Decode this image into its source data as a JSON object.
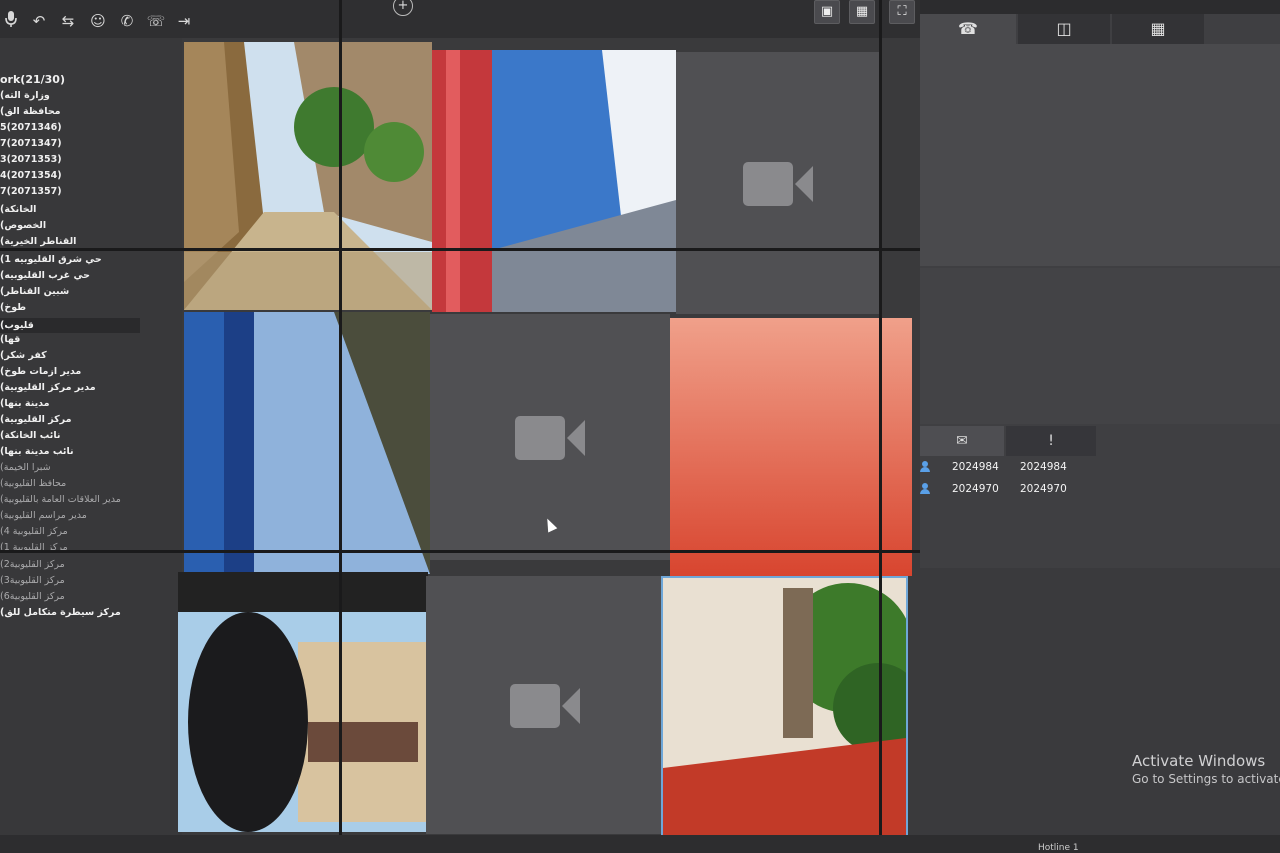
{
  "toolbar": {
    "icons": [
      "microphone-icon",
      "call-back-icon",
      "transfer-icon",
      "contact-icon",
      "phone-icon",
      "hangup-icon",
      "exit-icon"
    ],
    "add_camera_glyph": "+",
    "screen_layout_glyph": "▣",
    "grid_layout_glyph": "▦",
    "fullscreen_glyph": "⛶"
  },
  "tree": {
    "items": [
      {
        "label": "ork(21/30)",
        "dim": false
      },
      {
        "label": "(وزارة الته",
        "dim": false
      },
      {
        "label": "(محافظة الق",
        "dim": false
      },
      {
        "label": "5(2071346)",
        "dim": false
      },
      {
        "label": "7(2071347)",
        "dim": false
      },
      {
        "label": "3(2071353)",
        "dim": false
      },
      {
        "label": "4(2071354)",
        "dim": false
      },
      {
        "label": "7(2071357)",
        "dim": false
      },
      {
        "label": "(الخانكة",
        "dim": false
      },
      {
        "label": "(الخصوص",
        "dim": false
      },
      {
        "label": "(القناطر الخيرية",
        "dim": false
      },
      {
        "label": "(حي شرق القليوبيه 1",
        "dim": false
      },
      {
        "label": "(حي غرب القليوبيه",
        "dim": false
      },
      {
        "label": "(شبين القناطر",
        "dim": false
      },
      {
        "label": "(طوخ",
        "dim": false
      },
      {
        "label": "(قليوب",
        "dim": false
      },
      {
        "label": "(قها",
        "dim": false
      },
      {
        "label": "(كفر شكر",
        "dim": false
      },
      {
        "label": "(مدير ازمات طوخ",
        "dim": false
      },
      {
        "label": "(مدير مركز القليوبية",
        "dim": false
      },
      {
        "label": "(مدينة بنها",
        "dim": false
      },
      {
        "label": "(مركز القليوبية",
        "dim": false
      },
      {
        "label": "(نائب الخانكة",
        "dim": false
      },
      {
        "label": "(نائب مدينة بنها",
        "dim": false
      },
      {
        "label": "(شبرا الخيمة",
        "dim": true
      },
      {
        "label": "(محافظ القليوبية",
        "dim": true
      },
      {
        "label": "(مدير العلاقات العامة بالقليوبية",
        "dim": true
      },
      {
        "label": "(مدير مراسم القليوبية",
        "dim": true
      },
      {
        "label": "(مركز القليوبية 4",
        "dim": true
      },
      {
        "label": "(مركز القليوبية 1",
        "dim": true
      },
      {
        "label": "(مركز القليوبية2",
        "dim": true
      },
      {
        "label": "(مركز القليوبية3",
        "dim": true
      },
      {
        "label": "(مركز القليوبية6",
        "dim": true
      },
      {
        "label": "(مركز سيطرة متكامل للق",
        "dim": false
      }
    ]
  },
  "video_wall": {
    "tiles": [
      {
        "id": "tile-1",
        "state": "live"
      },
      {
        "id": "tile-2",
        "state": "live"
      },
      {
        "id": "tile-3",
        "state": "empty"
      },
      {
        "id": "tile-4",
        "state": "live"
      },
      {
        "id": "tile-5",
        "state": "empty"
      },
      {
        "id": "tile-6",
        "state": "live"
      },
      {
        "id": "tile-7",
        "state": "live"
      },
      {
        "id": "tile-8",
        "state": "empty"
      },
      {
        "id": "tile-9",
        "state": "live",
        "selected": true
      }
    ]
  },
  "right_panel": {
    "tabs": [
      {
        "icon": "phone-icon",
        "glyph": "☎"
      },
      {
        "icon": "cctv-icon",
        "glyph": "◫"
      },
      {
        "icon": "video-grid-icon",
        "glyph": "▦"
      }
    ],
    "message_tabs": [
      {
        "icon": "mail-icon",
        "glyph": "✉"
      },
      {
        "icon": "alert-icon",
        "glyph": "!"
      }
    ],
    "users": [
      {
        "id": "2024984",
        "name": "2024984"
      },
      {
        "id": "2024970",
        "name": "2024970"
      }
    ]
  },
  "watermark": {
    "title": "Activate Windows",
    "subtitle": "Go to Settings to activate W"
  },
  "status": {
    "text": "Hotline 1"
  }
}
